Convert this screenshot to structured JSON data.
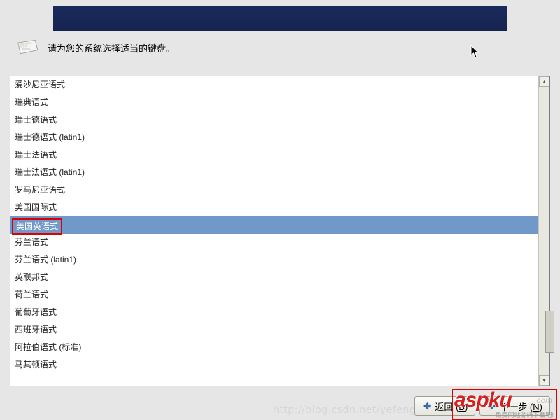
{
  "banner": "",
  "prompt": "请为您的系统选择适当的键盘。",
  "keyboard_items": [
    {
      "label": "爱沙尼亚语式",
      "selected": false
    },
    {
      "label": "瑞典语式",
      "selected": false
    },
    {
      "label": "瑞士德语式",
      "selected": false
    },
    {
      "label": "瑞士德语式 (latin1)",
      "selected": false
    },
    {
      "label": "瑞士法语式",
      "selected": false
    },
    {
      "label": "瑞士法语式 (latin1)",
      "selected": false
    },
    {
      "label": "罗马尼亚语式",
      "selected": false
    },
    {
      "label": "美国国际式",
      "selected": false
    },
    {
      "label": "美国英语式",
      "selected": true
    },
    {
      "label": "芬兰语式",
      "selected": false
    },
    {
      "label": "芬兰语式 (latin1)",
      "selected": false
    },
    {
      "label": "英联邦式",
      "selected": false
    },
    {
      "label": "荷兰语式",
      "selected": false
    },
    {
      "label": "葡萄牙语式",
      "selected": false
    },
    {
      "label": "西班牙语式",
      "selected": false
    },
    {
      "label": "阿拉伯语式 (标准)",
      "selected": false
    },
    {
      "label": "马其顿语式",
      "selected": false
    }
  ],
  "buttons": {
    "back_prefix": "返回 (",
    "back_mnemonic": "B",
    "back_suffix": ")",
    "next_prefix": "下一步 (",
    "next_mnemonic": "N",
    "next_suffix": ")"
  },
  "watermark_url": "http://blog.csdn.net/yefeng",
  "watermark_logo_text": "aspku",
  "watermark_dotcom": ".com",
  "watermark_subtitle": "免费网站源码下载吧!"
}
